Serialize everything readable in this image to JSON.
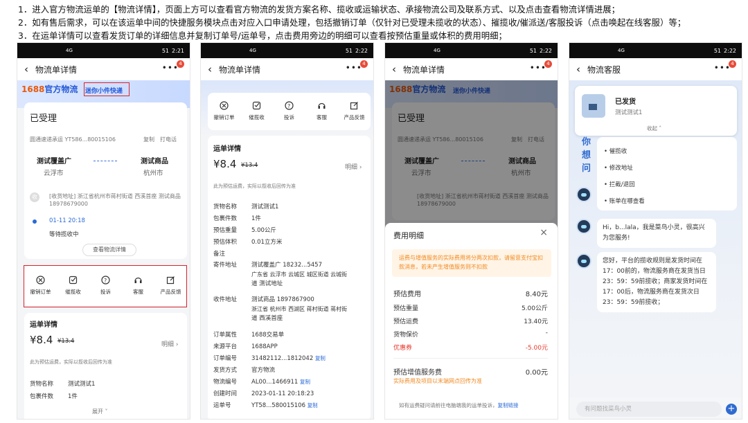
{
  "notes": [
    "1．进入官方物流运单的【物流详情】，页面上方可以查看官方物流的发货方案名称、揽收或运输状态、承接物流公司及联系方式、以及点击查看物流详情进展；",
    "2．如有售后需求，可以在该运单中间的快捷服务模块点击对应入口申请处理，包括撤销订单（仅针对已受理未揽收的状态）、摧揽收/催派送/客服投诉（点击唤起在线客服）等；",
    "3．在运单详情可以查看发货订单的详细信息并复制订单号/运单号，点击费用旁边的明细可以查看按预估重量或体积的费用明细；"
  ],
  "status": {
    "time1": "2:21",
    "time2": "2:22",
    "time3": "2:22",
    "time4": "2:22",
    "net": "4G",
    "battery": "51"
  },
  "nav": {
    "title1": "物流单详情",
    "title2": "物流单详情",
    "title3": "物流单详情",
    "title4": "物流客服",
    "badge": "4"
  },
  "brand": {
    "p1": "1688",
    "p2": "官方物流",
    "plan": "迷你小件快递"
  },
  "order": {
    "state": "已受理",
    "carrier": "圆通速递承运 YT586...80015106",
    "copy": "复制",
    "call": "打电话",
    "from_name": "测试覆盖广",
    "from_city": "云浮市",
    "to_name": "测试商品",
    "to_city": "杭州市",
    "addr": "[收货地址] 浙江省杭州市蒋村街道 西溪首座 测试商品 18978679000",
    "time": "01-11 20:18",
    "wait": "等待揽收中",
    "detail_btn": "查看物流详情"
  },
  "services": [
    "撤销订单",
    "催揽收",
    "投诉",
    "客服",
    "产品反馈"
  ],
  "waybill": {
    "title": "运单详情",
    "price": "¥8.4",
    "orig": "¥13.4",
    "detail": "明细",
    "note": "此为预估运费，实际以揽收后回传为准",
    "goods_k": "货物名称",
    "goods_v": "测试测试1",
    "count_k": "包裹件数",
    "count_v": "1件",
    "weight_k": "预估重量",
    "weight_v": "5.00公斤",
    "vol_k": "预估体积",
    "vol_v": "0.01立方米",
    "remark_k": "备注",
    "sender_k": "寄件地址",
    "sender_v1": "测试覆盖广  18232...5457",
    "sender_v2": "广东省 云浮市 云城区 城区街道 云城街",
    "sender_v3": "道 测试地址",
    "recv_k": "收件地址",
    "recv_v1": "测试商品  1897867900",
    "recv_v2": "浙江省 杭州市 西湖区 蒋村街道 蒋村街",
    "recv_v3": "道 西溪首座",
    "attr_k": "订单属性",
    "attr_v": "1688交易单",
    "src_k": "来源平台",
    "src_v": "1688APP",
    "ono_k": "订单编号",
    "ono_v": "31482112...1812042",
    "ship_k": "发货方式",
    "ship_v": "官方物流",
    "lno_k": "物流编号",
    "lno_v": "AL00...1466911",
    "ctime_k": "创建时间",
    "ctime_v": "2023-01-11 20:18:23",
    "wno_k": "运单号",
    "wno_v": "YT58...580015106",
    "copy": "复制",
    "expand": "展开"
  },
  "fee": {
    "title": "费用明细",
    "warn": "运费与增值服务的实际费用将分两次扣款，请留意支付宝扣款消息，若未产生增值服务则不扣款",
    "est_k": "预估费用",
    "est_v": "8.40元",
    "w_k": "预估重量",
    "w_v": "5.00公斤",
    "f_k": "预估运费",
    "f_v": "13.40元",
    "ins_k": "货物保价",
    "ins_v": "-",
    "cp_k": "优惠券",
    "cp_v": "-5.00元",
    "vas_k": "预估增值服务费",
    "vas_v": "0.00元",
    "vas_note": "实际费用及项目以末端网点回传为准",
    "foot": "如有运费疑问请前往电脑端我的运单投诉，",
    "foot_link": "复制链接"
  },
  "chat": {
    "shipped": "已发货",
    "item": "测试测试1",
    "fold": "收起",
    "ask": "你想问",
    "q1": "催揽收",
    "q2": "修改地址",
    "q3": "拦截/退回",
    "q4": "账单在哪查看",
    "msg1": "Hi，b...lala，我是菜鸟小灵，很高兴为您服务!",
    "msg2": "您好，平台的揽收规则是发货时间在17：00前的，物流服务商在发货当日23：59：59前揽收；商家发货时间在17：00后，物流服务商在发货次日23：59：59前揽收；",
    "input_ph": "有问题找菜鸟小灵"
  }
}
